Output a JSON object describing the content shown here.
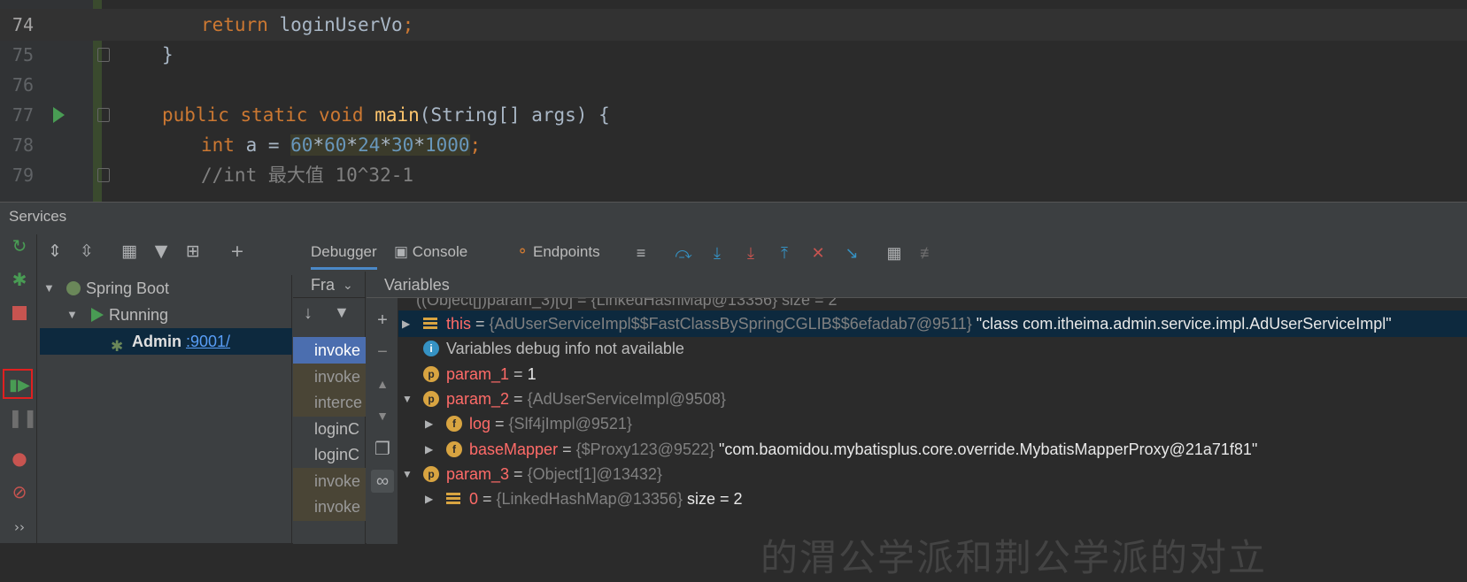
{
  "editor": {
    "lines": [
      {
        "number": "74",
        "tokens": [
          {
            "t": "return ",
            "c": "kw"
          },
          {
            "t": "loginUserVo",
            "c": "plain"
          },
          {
            "t": ";",
            "c": "kw"
          }
        ],
        "indent": 2,
        "current": true
      },
      {
        "number": "75",
        "tokens": [
          {
            "t": "}",
            "c": "plain"
          }
        ],
        "indent": 1,
        "current": false
      },
      {
        "number": "76",
        "tokens": [],
        "indent": 0,
        "current": false
      },
      {
        "number": "77",
        "tokens": [
          {
            "t": "public static void ",
            "c": "kw"
          },
          {
            "t": "main",
            "c": "fn"
          },
          {
            "t": "(String[] args) {",
            "c": "plain"
          }
        ],
        "indent": 1,
        "current": false
      },
      {
        "number": "78",
        "tokens": [
          {
            "t": "int ",
            "c": "kw"
          },
          {
            "t": "a = ",
            "c": "plain"
          },
          {
            "t": "60",
            "c": "num"
          },
          {
            "t": "*",
            "c": "plain"
          },
          {
            "t": "60",
            "c": "num"
          },
          {
            "t": "*",
            "c": "plain"
          },
          {
            "t": "24",
            "c": "num"
          },
          {
            "t": "*",
            "c": "plain"
          },
          {
            "t": "30",
            "c": "num"
          },
          {
            "t": "*",
            "c": "plain"
          },
          {
            "t": "1000",
            "c": "num"
          },
          {
            "t": ";",
            "c": "kw"
          }
        ],
        "indent": 2,
        "current": false
      },
      {
        "number": "79",
        "tokens": [
          {
            "t": "//int 最大值 10^32-1",
            "c": "cmt"
          }
        ],
        "indent": 2,
        "current": false
      }
    ]
  },
  "services": {
    "title": "Services",
    "tree": {
      "root": "Spring Boot",
      "group": "Running",
      "app_name": "Admin",
      "app_port": ":9001/"
    },
    "tabs": {
      "debugger": "Debugger",
      "console": "Console",
      "endpoints": "Endpoints"
    },
    "frames": {
      "header": "Fra",
      "rows": [
        {
          "label": "invoke",
          "style": "sel"
        },
        {
          "label": "invoke",
          "style": "lib"
        },
        {
          "label": "interce",
          "style": "lib"
        },
        {
          "label": "loginC",
          "style": "norm"
        },
        {
          "label": "loginC",
          "style": "norm"
        },
        {
          "label": "invoke",
          "style": "lib"
        },
        {
          "label": "invoke",
          "style": "lib"
        }
      ]
    },
    "variables": {
      "header": "Variables",
      "partial_row": "((Object[])param_3)[0] = {LinkedHashMap@13356} size = 2",
      "rows": [
        {
          "tri": "▶",
          "icon": "bar",
          "name": "this",
          "name_style": "red",
          "eq": " = ",
          "type": "{AdUserServiceImpl$$FastClassBySpringCGLIB$$6efadab7@9511}",
          "value": " \"class com.itheima.admin.service.impl.AdUserServiceImpl\"",
          "indent": 0,
          "selected": true
        },
        {
          "tri": "",
          "icon": "i",
          "name": "Variables debug info not available",
          "name_style": "plain",
          "eq": "",
          "type": "",
          "value": "",
          "indent": 0,
          "selected": false
        },
        {
          "tri": "",
          "icon": "p",
          "name": "param_1",
          "name_style": "red",
          "eq": " = ",
          "type": "",
          "value": "1",
          "indent": 0,
          "selected": false
        },
        {
          "tri": "▼",
          "icon": "p",
          "name": "param_2",
          "name_style": "red",
          "eq": " = ",
          "type": "{AdUserServiceImpl@9508}",
          "value": "",
          "indent": 0,
          "selected": false
        },
        {
          "tri": "▶",
          "icon": "f",
          "name": "log",
          "name_style": "red",
          "eq": " = ",
          "type": "{Slf4jImpl@9521}",
          "value": "",
          "indent": 1,
          "selected": false
        },
        {
          "tri": "▶",
          "icon": "f",
          "name": "baseMapper",
          "name_style": "red",
          "eq": " = ",
          "type": "{$Proxy123@9522}",
          "value": " \"com.baomidou.mybatisplus.core.override.MybatisMapperProxy@21a71f81\"",
          "indent": 1,
          "selected": false
        },
        {
          "tri": "▼",
          "icon": "p",
          "name": "param_3",
          "name_style": "red",
          "eq": " = ",
          "type": "{Object[1]@13432}",
          "value": "",
          "indent": 0,
          "selected": false
        },
        {
          "tri": "▶",
          "icon": "bar",
          "name": "0",
          "name_style": "red",
          "eq": " = ",
          "type": "{LinkedHashMap@13356}",
          "value": "  size = 2",
          "indent": 1,
          "selected": false
        }
      ]
    },
    "watermark": "的渭公学派和荆公学派的对立"
  }
}
